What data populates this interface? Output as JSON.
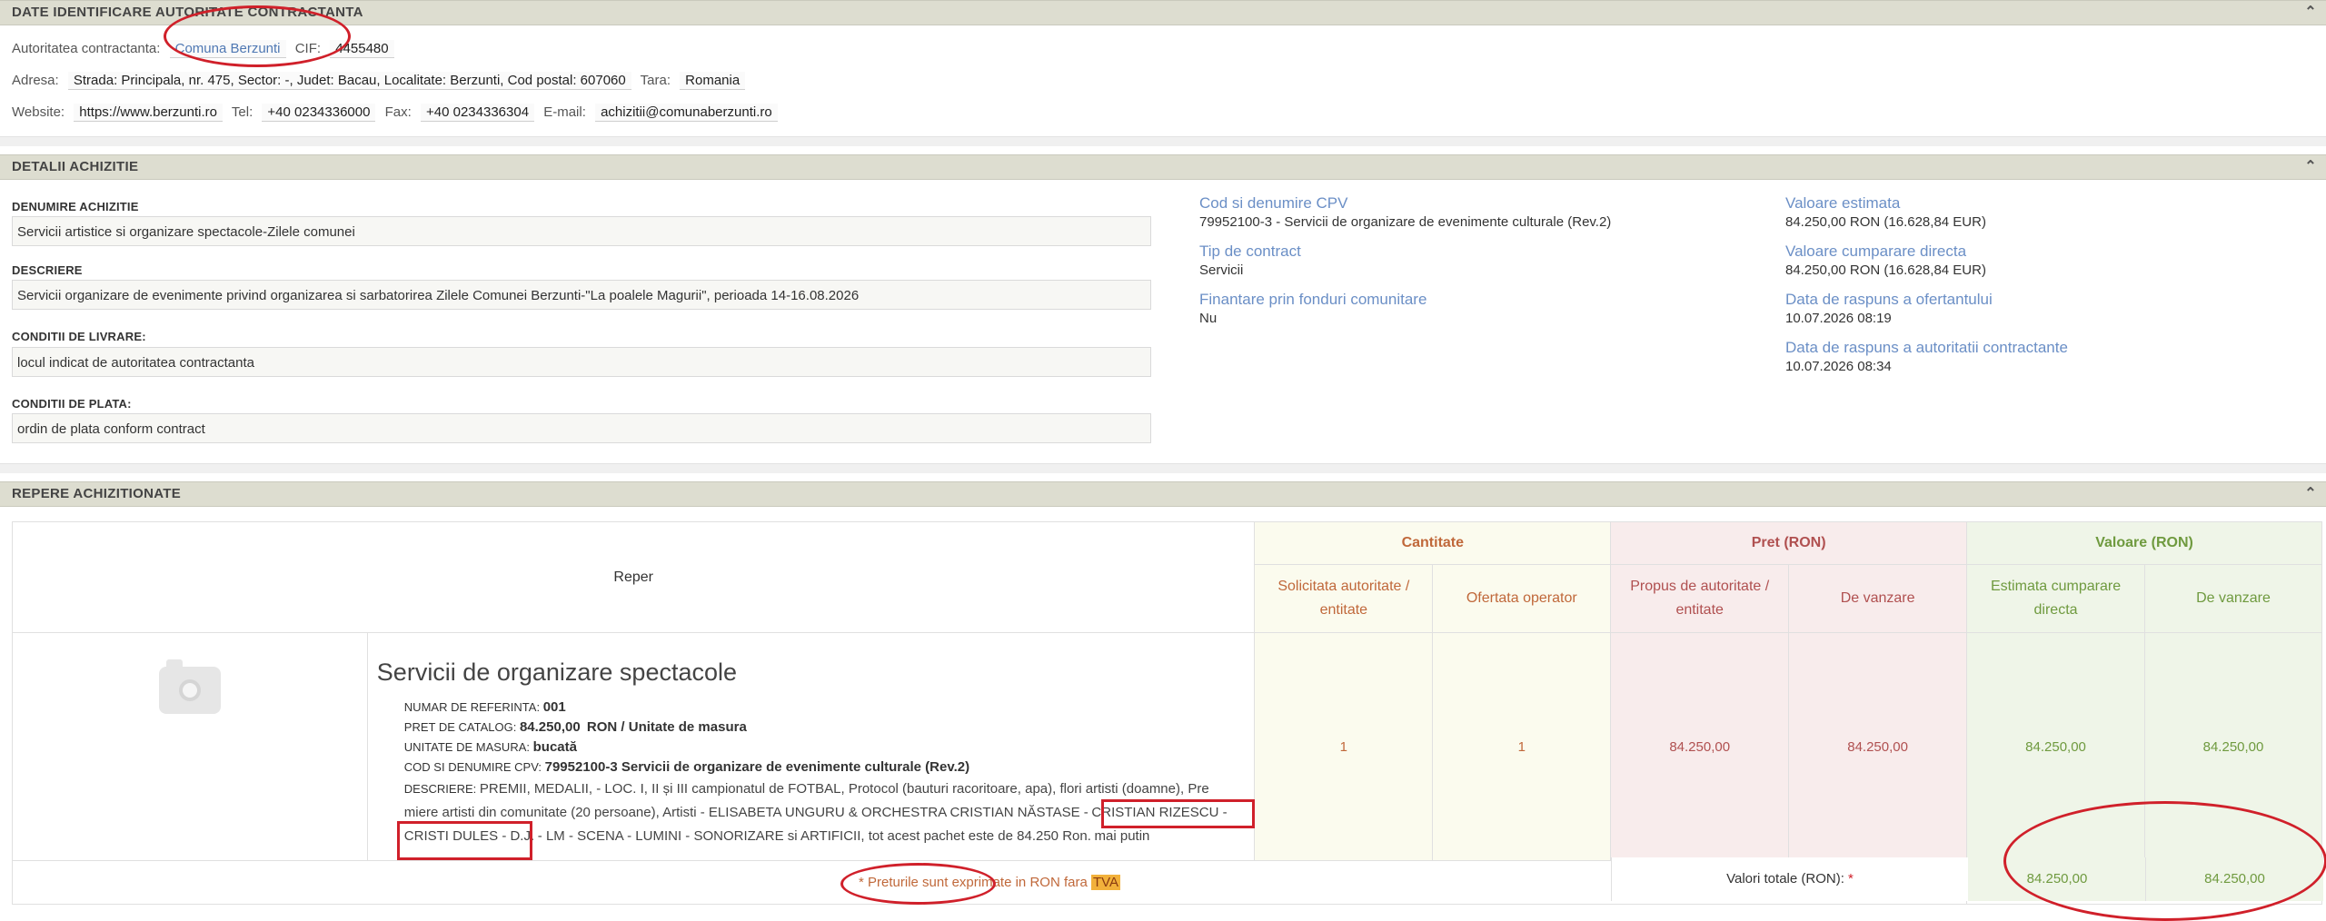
{
  "sec1": {
    "title": "DATE IDENTIFICARE AUTORITATE CONTRACTANTA",
    "autoritate_label": "Autoritatea contractanta:",
    "autoritate_value": "Comuna Berzunti",
    "cif_label": "CIF:",
    "cif_value": "4455480",
    "adresa_label": "Adresa:",
    "adresa_value": "Strada: Principala, nr. 475, Sector: -, Judet: Bacau, Localitate: Berzunti, Cod postal: 607060",
    "tara_label": "Tara:",
    "tara_value": "Romania",
    "website_label": "Website:",
    "website_value": "https://www.berzunti.ro",
    "tel_label": "Tel:",
    "tel_value": "+40 0234336000",
    "fax_label": "Fax:",
    "fax_value": "+40 0234336304",
    "email_label": "E-mail:",
    "email_value": "achizitii@comunaberzunti.ro"
  },
  "sec2": {
    "title": "DETALII ACHIZITIE",
    "denumire_label": "DENUMIRE ACHIZITIE",
    "denumire_value": "Servicii artistice si organizare spectacole-Zilele comunei",
    "descriere_label": "DESCRIERE",
    "descriere_value": "Servicii organizare de evenimente privind organizarea si sarbatorirea Zilele Comunei Berzunti-\"La poalele Magurii\", perioada 14-16.08.2026",
    "livrare_label": "CONDITII DE LIVRARE:",
    "livrare_value": "locul indicat de autoritatea contractanta",
    "plata_label": "CONDITII DE PLATA:",
    "plata_value": "ordin de plata conform contract",
    "cpv_title": "Cod si denumire CPV",
    "cpv_value": "79952100-3 - Servicii de organizare de evenimente culturale (Rev.2)",
    "tip_title": "Tip de contract",
    "tip_value": "Servicii",
    "fonduri_title": "Finantare prin fonduri comunitare",
    "fonduri_value": "Nu",
    "val_est_title": "Valoare estimata",
    "val_est_value": "84.250,00  RON (16.628,84  EUR)",
    "val_cump_title": "Valoare cumparare directa",
    "val_cump_value": "84.250,00  RON (16.628,84  EUR)",
    "data_ofertant_title": "Data de raspuns a ofertantului",
    "data_ofertant_value": "10.07.2026 08:19",
    "data_autoritate_title": "Data de raspuns a autoritatii contractante",
    "data_autoritate_value": "10.07.2026 08:34"
  },
  "sec3": {
    "title": "REPERE ACHIZITIONATE",
    "col_reper": "Reper",
    "grp_cantitate": "Cantitate",
    "grp_pret": "Pret (RON)",
    "grp_valoare": "Valoare (RON)",
    "sub_solicitata": "Solicitata autoritate / entitate",
    "sub_ofertata": "Ofertata operator",
    "sub_propus": "Propus de autoritate / entitate",
    "sub_vanzare_pret": "De vanzare",
    "sub_estimata": "Estimata cumparare directa",
    "sub_vanzare_val": "De vanzare",
    "item": {
      "title": "Servicii de organizare spectacole",
      "ref_label": "NUMAR DE REFERINTA:",
      "ref_value": "001",
      "pret_label": "PRET DE CATALOG:",
      "pret_value": "84.250,00",
      "pret_unit": "RON / Unitate de masura",
      "um_label": "UNITATE DE MASURA:",
      "um_value": "bucată",
      "cpv_label": "COD SI DENUMIRE CPV:",
      "cpv_value": "79952100-3 Servicii de organizare de evenimente culturale (Rev.2)",
      "desc_label": "DESCRIERE:",
      "desc_line1": "PREMII, MEDALII, - LOC. I, II și III campionatul de FOTBAL, Protocol (bauturi racoritoare, apa), flori artisti (doamne), Pre",
      "desc_line2a": "miere artisti din comunitate (20 persoane), Artisti - ELISABETA UNGURU & ORCHESTRA CRISTIAN NĂSTASE -",
      "desc_line2b": "CRISTIAN RIZESCU -",
      "desc_line3a": "CRISTI DULES - D.J.",
      "desc_line3b": "- LM - SCENA - LUMINI - SONORIZARE si ARTIFICII, tot acest pachet este de 84.250 Ron.",
      "mai_putin": "mai putin",
      "cant_solicitata": "1",
      "cant_ofertata": "1",
      "pret_propus": "84.250,00",
      "pret_vanzare": "84.250,00",
      "val_estimata": "84.250,00",
      "val_vanzare": "84.250,00"
    },
    "note_prefix": "* Preturile sunt exprimate in RON fara",
    "note_tva": "TVA",
    "totals_label": "Valori totale (RON):",
    "totals_star": "*",
    "total_estimata": "84.250,00",
    "total_vanzare": "84.250,00"
  },
  "colors": {
    "header_bg": "#ddddd0",
    "link_blue": "#4f78b3",
    "annotation_red": "#d0202a"
  }
}
